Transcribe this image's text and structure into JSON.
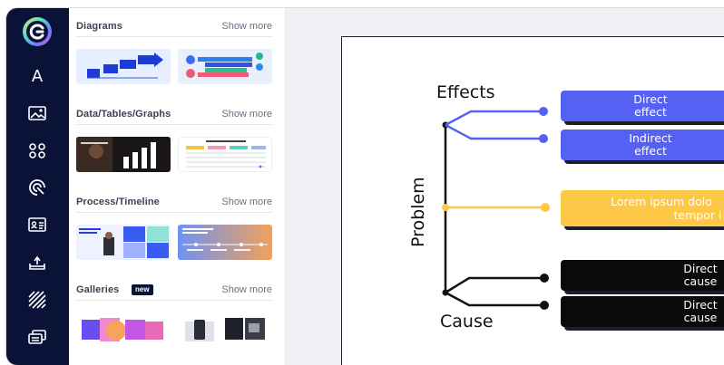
{
  "sidebar": {
    "items": [
      {
        "icon": "text-icon",
        "glyph": "A"
      },
      {
        "icon": "image-icon"
      },
      {
        "icon": "elements-icon"
      },
      {
        "icon": "ai-icon"
      },
      {
        "icon": "id-card-icon"
      },
      {
        "icon": "upload-icon"
      },
      {
        "icon": "pattern-icon"
      },
      {
        "icon": "layers-icon"
      }
    ]
  },
  "panel": {
    "sections": [
      {
        "title": "Diagrams",
        "show_more": "Show more"
      },
      {
        "title": "Data/Tables/Graphs",
        "show_more": "Show more"
      },
      {
        "title": "Process/Timeline",
        "show_more": "Show more"
      },
      {
        "title": "Galleries",
        "show_more": "Show more",
        "badge": "new"
      }
    ]
  },
  "slide": {
    "effects_label": "Effects",
    "cause_label": "Cause",
    "axis_label": "Problem",
    "boxes": [
      {
        "line1": "Direct",
        "line2": "effect",
        "color": "#5561f2"
      },
      {
        "line1": "Indirect",
        "line2": "effect",
        "color": "#5561f2"
      },
      {
        "line1": "Lorem ipsum dolo",
        "line2": "tempor i",
        "color": "#fcc846"
      },
      {
        "line1": "Direct",
        "line2": "cause",
        "color": "#0a0a0a"
      },
      {
        "line1": "Direct",
        "line2": "cause",
        "color": "#0a0a0a"
      }
    ]
  },
  "colors": {
    "rail": "#0b1237",
    "accent_blue": "#5561f2",
    "accent_yellow": "#fcc846"
  }
}
